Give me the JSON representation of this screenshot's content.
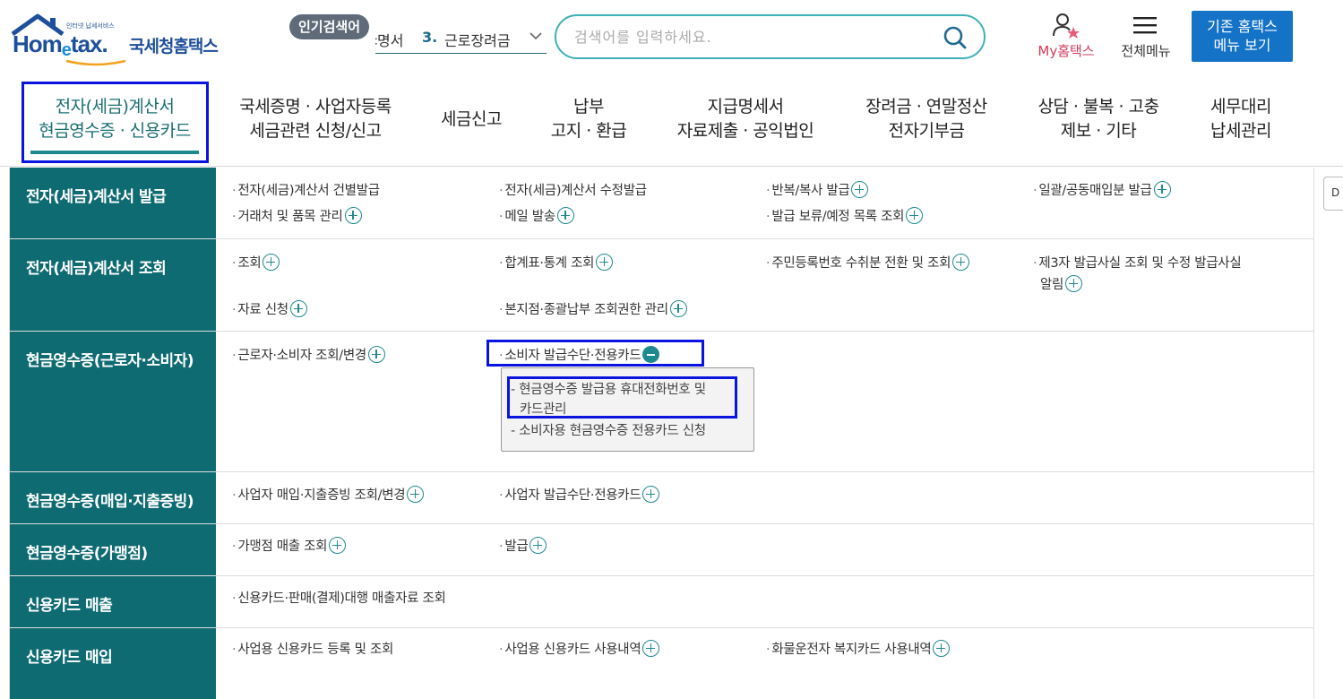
{
  "header": {
    "logo": {
      "tagline": "인터넷 납세서비스",
      "brand_prefix": "Hom",
      "brand_e": "e",
      "brand_suffix": "tax.",
      "korean_name": "국세청홈택스"
    },
    "popular": {
      "badge": "인기검색어",
      "prev_fragment": "‡명서",
      "rank": "3.",
      "term": "근로장려금"
    },
    "search": {
      "placeholder": "검색어를 입력하세요."
    },
    "my_hometax": "My홈택스",
    "all_menu": "전체메뉴",
    "legacy_button": {
      "line1": "기존 홈택스",
      "line2": "메뉴 보기"
    }
  },
  "gnb": [
    {
      "line1": "전자(세금)계산서",
      "line2": "현금영수증 · 신용카드",
      "active": true
    },
    {
      "line1": "국세증명 · 사업자등록",
      "line2": "세금관련 신청/신고"
    },
    {
      "line1": "세금신고",
      "line2": ""
    },
    {
      "line1": "납부",
      "line2": "고지 · 환급"
    },
    {
      "line1": "지급명세서",
      "line2": "자료제출 · 공익법인"
    },
    {
      "line1": "장려금 · 연말정산",
      "line2": "전자기부금"
    },
    {
      "line1": "상담 · 불복 · 고충",
      "line2": "제보 · 기타"
    },
    {
      "line1": "세무대리",
      "line2": "납세관리"
    }
  ],
  "mega": {
    "dot": "·",
    "rows": [
      {
        "category": "전자(세금)계산서 발급",
        "items": [
          "전자(세금)계산서 건별발급",
          "전자(세금)계산서 수정발급",
          "반복/복사 발급",
          "일괄/공동매입분 발급",
          "거래처 및 품목 관리",
          "메일 발송",
          "발급 보류/예정 목록 조회"
        ]
      },
      {
        "category": "전자(세금)계산서 조회",
        "items": [
          "조회",
          "합계표·통계 조회",
          "주민등록번호 수취분 전환 및 조회",
          "제3자 발급사실 조회 및 수정 발급사실",
          "알림",
          "자료 신청",
          "본지점·종괄납부 조회권한 관리"
        ]
      },
      {
        "category": "현금영수증(근로자·소비자)",
        "items": [
          "근로자·소비자 조회/변경",
          "소비자 발급수단·전용카드"
        ],
        "submenu": [
          "- 현금영수증 발급용 휴대전화번호 및",
          "카드관리",
          "- 소비자용 현금영수증 전용카드 신청"
        ]
      },
      {
        "category": "현금영수증(매입·지출증빙)",
        "items": [
          "사업자 매입·지출증빙 조회/변경",
          "사업자 발급수단·전용카드"
        ]
      },
      {
        "category": "현금영수증(가맹점)",
        "items": [
          "가맹점 매출 조회",
          "발급"
        ]
      },
      {
        "category": "신용카드 매출",
        "items": [
          "신용카드·판매(결제)대행 매출자료 조회"
        ]
      },
      {
        "category": "신용카드 매입",
        "items": [
          "사업용 신용카드 등록 및 조회",
          "사업용 신용카드 사용내역",
          "화물운전자 복지카드 사용내역"
        ]
      }
    ]
  },
  "side_button": "D",
  "colors": {
    "teal": "#0f6b72",
    "accent": "#1e8a8f",
    "highlight": "#0a14e0",
    "button_blue": "#1473c6",
    "my_red": "#d13c5a"
  }
}
